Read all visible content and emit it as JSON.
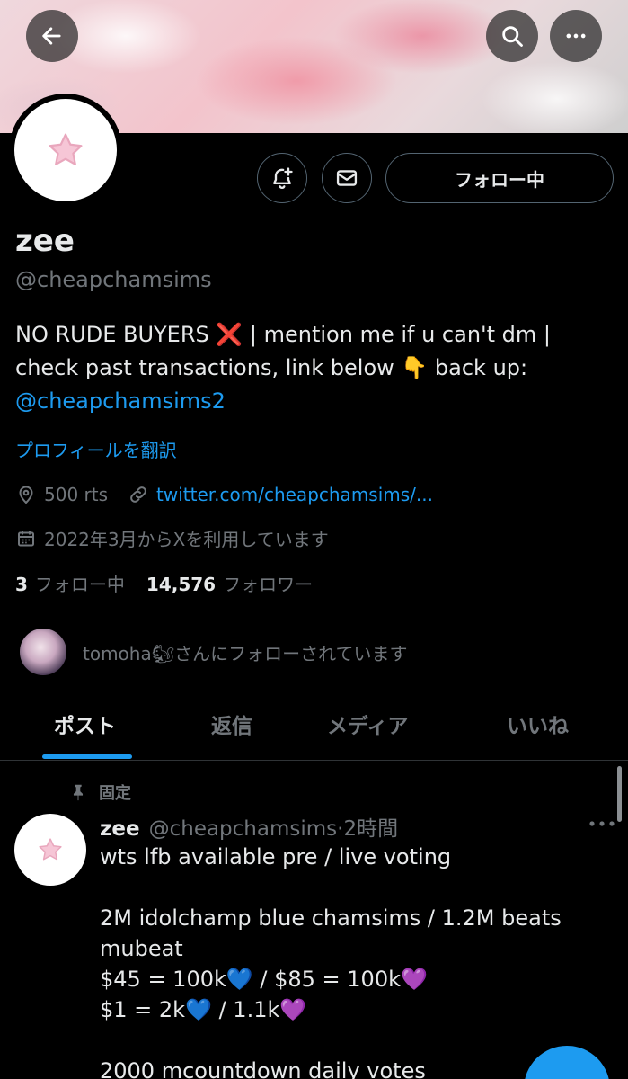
{
  "header": {
    "back_icon": "arrow-left-icon",
    "search_icon": "search-icon",
    "more_icon": "more-horizontal-icon"
  },
  "profile": {
    "avatar_icon": "pink-star-icon",
    "name": "zee",
    "handle": "@cheapchamsims",
    "bio_text": "NO RUDE BUYERS ❌ | mention me if u can't dm | check past transactions, link below 👇 back up: ",
    "bio_link": "@cheapchamsims2",
    "translate_label": "プロフィールを翻訳",
    "location": "500 rts",
    "website": "twitter.com/cheapchamsims/...",
    "joined": "2022年3月からXを利用しています",
    "following_count": "3",
    "following_label": "フォロー中",
    "followers_count": "14,576",
    "followers_label": "フォロワー",
    "followed_by_text": "tomoha🐿さんにフォローされています"
  },
  "actions": {
    "notify_icon": "bell-plus-icon",
    "message_icon": "envelope-icon",
    "follow_label": "フォロー中"
  },
  "tabs": [
    {
      "label": "ポスト",
      "active": true
    },
    {
      "label": "返信",
      "active": false
    },
    {
      "label": "メディア",
      "active": false
    },
    {
      "label": "いいね",
      "active": false
    }
  ],
  "post": {
    "pinned_label": "固定",
    "author_name": "zee",
    "author_handle": "@cheapchamsims",
    "time": "·2時間",
    "body": "wts lfb available pre / live voting\n\n2M idolchamp blue chamsims / 1.2M beats mubeat\n$45 = 100k💙 / $85 = 100k💜\n$1 = 2k💙 / 1.1k💜\n\n2000 mcountdown daily votes"
  },
  "colors": {
    "accent": "#1d9bf0",
    "muted": "#71767b",
    "text": "#e7e9ea",
    "border": "#2f3336"
  }
}
